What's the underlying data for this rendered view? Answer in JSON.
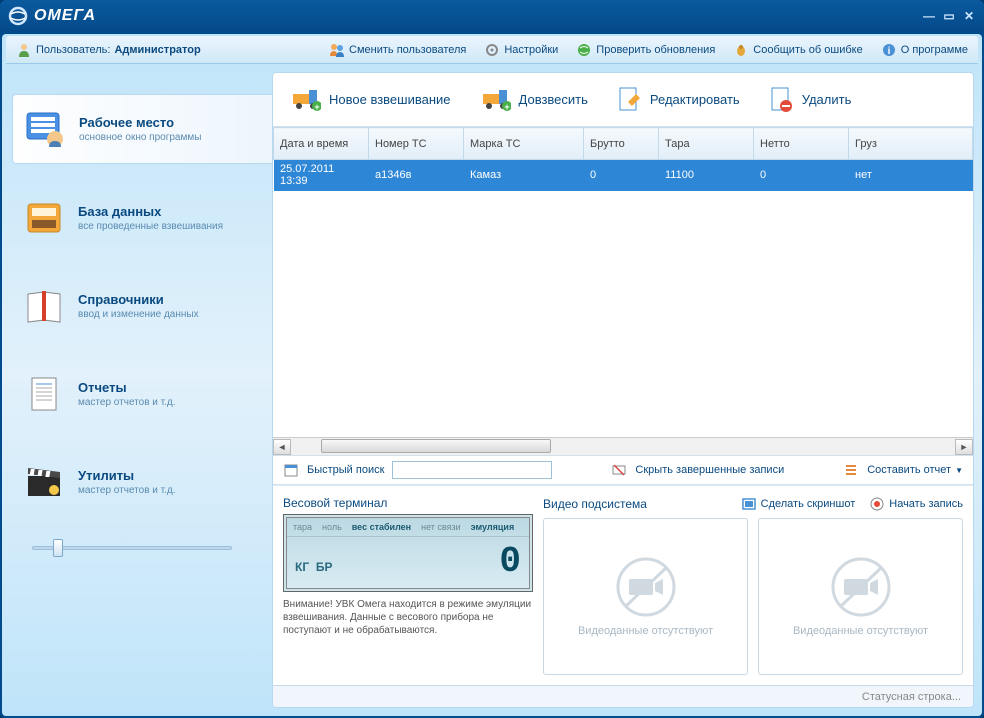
{
  "app": {
    "name": "ОМЕГА"
  },
  "user": {
    "label": "Пользователь:",
    "name": "Администратор"
  },
  "toolbar": {
    "switch_user": "Сменить пользователя",
    "settings": "Настройки",
    "check_updates": "Проверить обновления",
    "report_error": "Сообщить об ошибке",
    "about": "О программе"
  },
  "sidebar": {
    "items": [
      {
        "title": "Рабочее место",
        "subtitle": "основное окно программы"
      },
      {
        "title": "База данных",
        "subtitle": "все проведенные взвешивания"
      },
      {
        "title": "Справочники",
        "subtitle": "ввод и изменение данных"
      },
      {
        "title": "Отчеты",
        "subtitle": "мастер отчетов и т.д."
      },
      {
        "title": "Утилиты",
        "subtitle": "мастер отчетов и т.д."
      }
    ]
  },
  "actions": {
    "new_weighing": "Новое взвешивание",
    "add_weight": "Довзвесить",
    "edit": "Редактировать",
    "delete": "Удалить"
  },
  "table": {
    "headers": {
      "datetime": "Дата и время",
      "vehicle_no": "Номер ТС",
      "vehicle_brand": "Марка ТС",
      "gross": "Брутто",
      "tare": "Тара",
      "net": "Нетто",
      "cargo": "Груз"
    },
    "rows": [
      {
        "datetime": "25.07.2011 13:39",
        "vehicle_no": "а1346в",
        "vehicle_brand": "Камаз",
        "gross": "0",
        "tare": "11100",
        "net": "0",
        "cargo": "нет"
      }
    ]
  },
  "midbar": {
    "quick_search": "Быстрый поиск",
    "hide_completed": "Скрыть завершенные записи",
    "make_report": "Составить отчет"
  },
  "terminal": {
    "title": "Весовой терминал",
    "ind_tare": "тара",
    "ind_zero": "ноль",
    "ind_stable": "вес стабилен",
    "ind_nolink": "нет связи",
    "ind_emulation": "эмуляция",
    "unit_kg": "КГ",
    "unit_br": "БР",
    "value": "0",
    "warning": "Внимание! УВК Омега находится в режиме эмуляции взвешивания. Данные с весового прибора не поступают и не обрабатываются."
  },
  "video": {
    "title": "Видео подсистема",
    "screenshot": "Сделать скриншот",
    "record": "Начать запись",
    "no_data": "Видеоданные отсутствуют"
  },
  "status": "Статусная строка..."
}
